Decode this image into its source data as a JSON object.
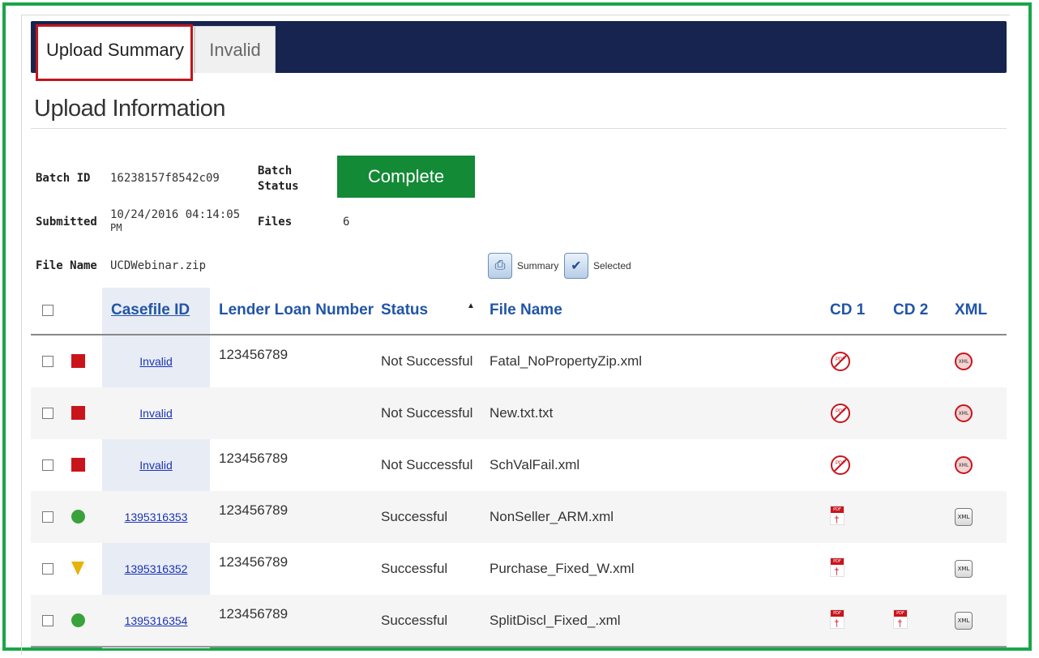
{
  "tabs": {
    "upload_summary": "Upload Summary",
    "invalid": "Invalid"
  },
  "section_title": "Upload Information",
  "batch": {
    "batch_id_label": "Batch ID",
    "batch_id": "16238157f8542c09",
    "batch_status_label_1": "Batch",
    "batch_status_label_2": "Status",
    "batch_status": "Complete",
    "submitted_label": "Submitted",
    "submitted_1": "10/24/2016 04:14:05",
    "submitted_2": "PM",
    "files_label": "Files",
    "files": "6",
    "file_name_label": "File Name",
    "file_name": "UCDWebinar.zip"
  },
  "downloads": {
    "summary": "Summary",
    "selected": "Selected"
  },
  "columns": {
    "casefile_id": "Casefile ID",
    "lender_loan_number": "Lender Loan Number",
    "status": "Status",
    "sort_indicator": "▲",
    "file_name": "File Name",
    "cd1": "CD 1",
    "cd2": "CD 2",
    "xml": "XML"
  },
  "rows": [
    {
      "indicator": "red-square",
      "casefile_id": "Invalid",
      "lender_loan_number": "123456789",
      "status": "Not Successful",
      "file_name": "Fatal_NoPropertyZip.xml",
      "cd1": "no-pdf-icon",
      "cd2": "",
      "xml": "no-xml-icon"
    },
    {
      "indicator": "red-square",
      "casefile_id": "Invalid",
      "lender_loan_number": "",
      "status": "Not Successful",
      "file_name": "New.txt.txt",
      "cd1": "no-pdf-icon",
      "cd2": "",
      "xml": "no-xml-icon"
    },
    {
      "indicator": "red-square",
      "casefile_id": "Invalid",
      "lender_loan_number": "123456789",
      "status": "Not Successful",
      "file_name": "SchValFail.xml",
      "cd1": "no-pdf-icon",
      "cd2": "",
      "xml": "no-xml-icon"
    },
    {
      "indicator": "green-circle",
      "casefile_id": "1395316353",
      "lender_loan_number": "123456789",
      "status": "Successful",
      "file_name": "NonSeller_ARM.xml",
      "cd1": "pdf-icon",
      "cd2": "",
      "xml": "xml-icon"
    },
    {
      "indicator": "yellow-triangle",
      "casefile_id": "1395316352",
      "lender_loan_number": "123456789",
      "status": "Successful",
      "file_name": "Purchase_Fixed_W.xml",
      "cd1": "pdf-icon",
      "cd2": "",
      "xml": "xml-icon"
    },
    {
      "indicator": "green-circle",
      "casefile_id": "1395316354",
      "lender_loan_number": "123456789",
      "status": "Successful",
      "file_name": "SplitDiscl_Fixed_.xml",
      "cd1": "pdf-icon",
      "cd2": "pdf-icon",
      "xml": "xml-icon"
    }
  ],
  "xml_icon_text": "XML",
  "colors": {
    "frame": "#1aa64a",
    "tabbar": "#172450",
    "complete": "#138a36",
    "link": "#1a33b5",
    "highlight": "#c0161c"
  }
}
